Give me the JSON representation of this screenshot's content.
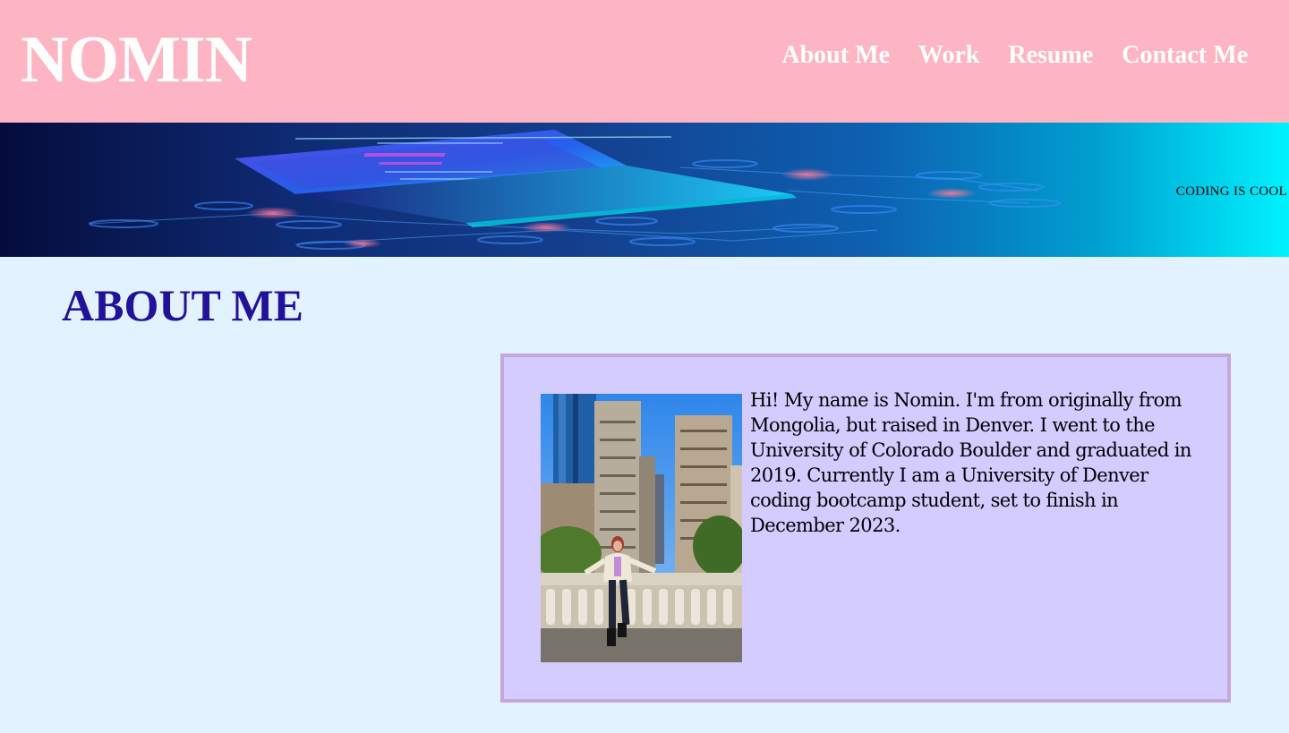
{
  "header": {
    "logo_text": "NOMIN",
    "nav": [
      {
        "label": "About Me"
      },
      {
        "label": "Work"
      },
      {
        "label": "Resume"
      },
      {
        "label": "Contact Me"
      }
    ],
    "background_color": "#feb5c3"
  },
  "hero": {
    "tagline": "CODING IS COOL",
    "image": "laptop-circuit-banner"
  },
  "about": {
    "title": "ABOUT ME",
    "photo": "portrait-photo-city-street",
    "bio": "Hi! My name is Nomin. I'm from originally from Mongolia, but raised in Denver. I went to the University of Colorado Boulder and graduated in 2019. Currently I am a University of Denver coding bootcamp student, set to finish in December 2023."
  },
  "colors": {
    "page_background": "#e2f3ff",
    "title_color": "#22129a",
    "card_background": "#d4ccff",
    "card_border": "#c7a6dc"
  }
}
